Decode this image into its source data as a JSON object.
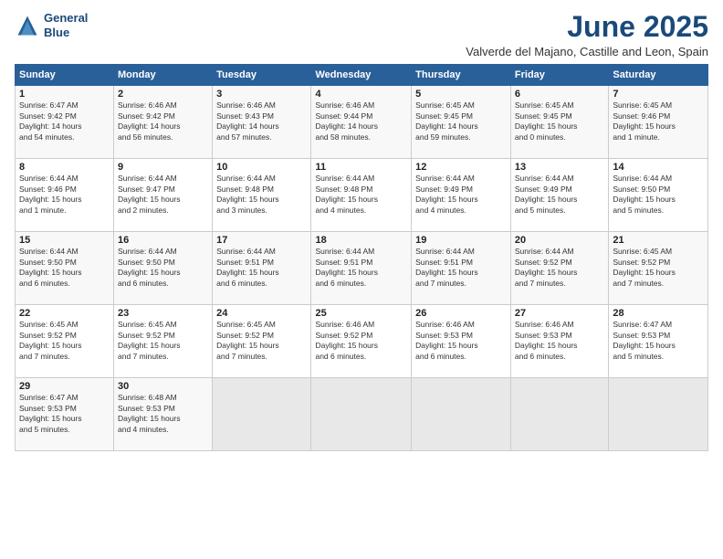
{
  "header": {
    "logo_line1": "General",
    "logo_line2": "Blue",
    "title": "June 2025",
    "subtitle": "Valverde del Majano, Castille and Leon, Spain"
  },
  "days_of_week": [
    "Sunday",
    "Monday",
    "Tuesday",
    "Wednesday",
    "Thursday",
    "Friday",
    "Saturday"
  ],
  "weeks": [
    [
      {
        "day": "1",
        "info": "Sunrise: 6:47 AM\nSunset: 9:42 PM\nDaylight: 14 hours\nand 54 minutes."
      },
      {
        "day": "2",
        "info": "Sunrise: 6:46 AM\nSunset: 9:42 PM\nDaylight: 14 hours\nand 56 minutes."
      },
      {
        "day": "3",
        "info": "Sunrise: 6:46 AM\nSunset: 9:43 PM\nDaylight: 14 hours\nand 57 minutes."
      },
      {
        "day": "4",
        "info": "Sunrise: 6:46 AM\nSunset: 9:44 PM\nDaylight: 14 hours\nand 58 minutes."
      },
      {
        "day": "5",
        "info": "Sunrise: 6:45 AM\nSunset: 9:45 PM\nDaylight: 14 hours\nand 59 minutes."
      },
      {
        "day": "6",
        "info": "Sunrise: 6:45 AM\nSunset: 9:45 PM\nDaylight: 15 hours\nand 0 minutes."
      },
      {
        "day": "7",
        "info": "Sunrise: 6:45 AM\nSunset: 9:46 PM\nDaylight: 15 hours\nand 1 minute."
      }
    ],
    [
      {
        "day": "8",
        "info": "Sunrise: 6:44 AM\nSunset: 9:46 PM\nDaylight: 15 hours\nand 1 minute."
      },
      {
        "day": "9",
        "info": "Sunrise: 6:44 AM\nSunset: 9:47 PM\nDaylight: 15 hours\nand 2 minutes."
      },
      {
        "day": "10",
        "info": "Sunrise: 6:44 AM\nSunset: 9:48 PM\nDaylight: 15 hours\nand 3 minutes."
      },
      {
        "day": "11",
        "info": "Sunrise: 6:44 AM\nSunset: 9:48 PM\nDaylight: 15 hours\nand 4 minutes."
      },
      {
        "day": "12",
        "info": "Sunrise: 6:44 AM\nSunset: 9:49 PM\nDaylight: 15 hours\nand 4 minutes."
      },
      {
        "day": "13",
        "info": "Sunrise: 6:44 AM\nSunset: 9:49 PM\nDaylight: 15 hours\nand 5 minutes."
      },
      {
        "day": "14",
        "info": "Sunrise: 6:44 AM\nSunset: 9:50 PM\nDaylight: 15 hours\nand 5 minutes."
      }
    ],
    [
      {
        "day": "15",
        "info": "Sunrise: 6:44 AM\nSunset: 9:50 PM\nDaylight: 15 hours\nand 6 minutes."
      },
      {
        "day": "16",
        "info": "Sunrise: 6:44 AM\nSunset: 9:50 PM\nDaylight: 15 hours\nand 6 minutes."
      },
      {
        "day": "17",
        "info": "Sunrise: 6:44 AM\nSunset: 9:51 PM\nDaylight: 15 hours\nand 6 minutes."
      },
      {
        "day": "18",
        "info": "Sunrise: 6:44 AM\nSunset: 9:51 PM\nDaylight: 15 hours\nand 6 minutes."
      },
      {
        "day": "19",
        "info": "Sunrise: 6:44 AM\nSunset: 9:51 PM\nDaylight: 15 hours\nand 7 minutes."
      },
      {
        "day": "20",
        "info": "Sunrise: 6:44 AM\nSunset: 9:52 PM\nDaylight: 15 hours\nand 7 minutes."
      },
      {
        "day": "21",
        "info": "Sunrise: 6:45 AM\nSunset: 9:52 PM\nDaylight: 15 hours\nand 7 minutes."
      }
    ],
    [
      {
        "day": "22",
        "info": "Sunrise: 6:45 AM\nSunset: 9:52 PM\nDaylight: 15 hours\nand 7 minutes."
      },
      {
        "day": "23",
        "info": "Sunrise: 6:45 AM\nSunset: 9:52 PM\nDaylight: 15 hours\nand 7 minutes."
      },
      {
        "day": "24",
        "info": "Sunrise: 6:45 AM\nSunset: 9:52 PM\nDaylight: 15 hours\nand 7 minutes."
      },
      {
        "day": "25",
        "info": "Sunrise: 6:46 AM\nSunset: 9:52 PM\nDaylight: 15 hours\nand 6 minutes."
      },
      {
        "day": "26",
        "info": "Sunrise: 6:46 AM\nSunset: 9:53 PM\nDaylight: 15 hours\nand 6 minutes."
      },
      {
        "day": "27",
        "info": "Sunrise: 6:46 AM\nSunset: 9:53 PM\nDaylight: 15 hours\nand 6 minutes."
      },
      {
        "day": "28",
        "info": "Sunrise: 6:47 AM\nSunset: 9:53 PM\nDaylight: 15 hours\nand 5 minutes."
      }
    ],
    [
      {
        "day": "29",
        "info": "Sunrise: 6:47 AM\nSunset: 9:53 PM\nDaylight: 15 hours\nand 5 minutes."
      },
      {
        "day": "30",
        "info": "Sunrise: 6:48 AM\nSunset: 9:53 PM\nDaylight: 15 hours\nand 4 minutes."
      },
      {
        "day": "",
        "info": ""
      },
      {
        "day": "",
        "info": ""
      },
      {
        "day": "",
        "info": ""
      },
      {
        "day": "",
        "info": ""
      },
      {
        "day": "",
        "info": ""
      }
    ]
  ]
}
